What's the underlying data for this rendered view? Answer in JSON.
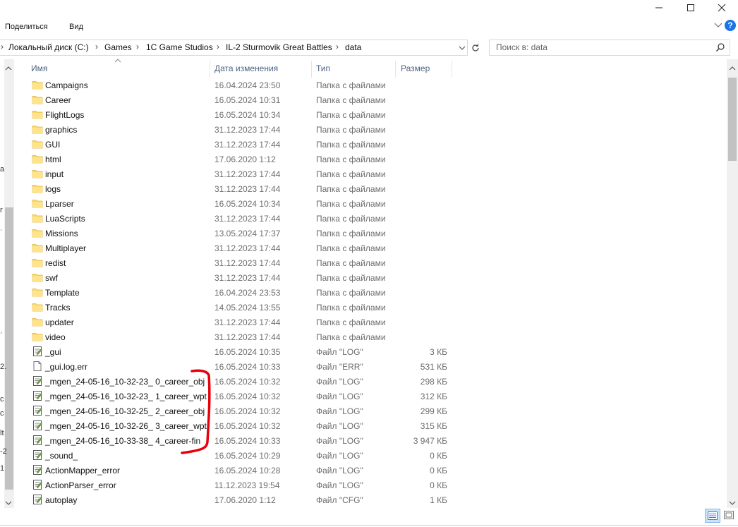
{
  "ribbon": {
    "share_tab": "Поделиться",
    "view_tab": "Вид"
  },
  "address": {
    "crumbs": [
      "Локальный диск (C:)",
      "Games",
      "1C Game Studios",
      "IL-2 Sturmovik Great Battles",
      "data"
    ]
  },
  "search": {
    "placeholder": "Поиск в: data"
  },
  "columns": {
    "name": "Имя",
    "date": "Дата изменения",
    "type": "Тип",
    "size": "Размер"
  },
  "nav_fragments": [
    "а",
    "r",
    "·",
    "·",
    "2.",
    "c",
    "c",
    "lt",
    "-2",
    "1"
  ],
  "files": [
    {
      "name": "Campaigns",
      "date": "16.04.2024 23:50",
      "type": "Папка с файлами",
      "size": "",
      "icon": "folder-icon"
    },
    {
      "name": "Career",
      "date": "16.05.2024 10:31",
      "type": "Папка с файлами",
      "size": "",
      "icon": "folder-icon"
    },
    {
      "name": "FlightLogs",
      "date": "16.05.2024 10:34",
      "type": "Папка с файлами",
      "size": "",
      "icon": "folder-icon"
    },
    {
      "name": "graphics",
      "date": "31.12.2023 17:44",
      "type": "Папка с файлами",
      "size": "",
      "icon": "folder-icon"
    },
    {
      "name": "GUI",
      "date": "31.12.2023 17:44",
      "type": "Папка с файлами",
      "size": "",
      "icon": "folder-icon"
    },
    {
      "name": "html",
      "date": "17.06.2020 1:12",
      "type": "Папка с файлами",
      "size": "",
      "icon": "folder-icon"
    },
    {
      "name": "input",
      "date": "31.12.2023 17:44",
      "type": "Папка с файлами",
      "size": "",
      "icon": "folder-icon"
    },
    {
      "name": "logs",
      "date": "31.12.2023 17:44",
      "type": "Папка с файлами",
      "size": "",
      "icon": "folder-icon"
    },
    {
      "name": "Lparser",
      "date": "16.05.2024 10:34",
      "type": "Папка с файлами",
      "size": "",
      "icon": "folder-icon"
    },
    {
      "name": "LuaScripts",
      "date": "31.12.2023 17:44",
      "type": "Папка с файлами",
      "size": "",
      "icon": "folder-icon"
    },
    {
      "name": "Missions",
      "date": "13.05.2024 17:37",
      "type": "Папка с файлами",
      "size": "",
      "icon": "folder-icon"
    },
    {
      "name": "Multiplayer",
      "date": "31.12.2023 17:44",
      "type": "Папка с файлами",
      "size": "",
      "icon": "folder-icon"
    },
    {
      "name": "redist",
      "date": "31.12.2023 17:44",
      "type": "Папка с файлами",
      "size": "",
      "icon": "folder-icon"
    },
    {
      "name": "swf",
      "date": "31.12.2023 17:44",
      "type": "Папка с файлами",
      "size": "",
      "icon": "folder-icon"
    },
    {
      "name": "Template",
      "date": "16.04.2024 23:53",
      "type": "Папка с файлами",
      "size": "",
      "icon": "folder-icon"
    },
    {
      "name": "Tracks",
      "date": "14.05.2024 13:55",
      "type": "Папка с файлами",
      "size": "",
      "icon": "folder-icon"
    },
    {
      "name": "updater",
      "date": "31.12.2023 17:44",
      "type": "Папка с файлами",
      "size": "",
      "icon": "folder-icon"
    },
    {
      "name": "video",
      "date": "31.12.2023 17:44",
      "type": "Папка с файлами",
      "size": "",
      "icon": "folder-icon"
    },
    {
      "name": "_gui",
      "date": "16.05.2024 10:35",
      "type": "Файл \"LOG\"",
      "size": "3 КБ",
      "icon": "log-file-icon"
    },
    {
      "name": "_gui.log.err",
      "date": "16.05.2024 10:33",
      "type": "Файл \"ERR\"",
      "size": "531 КБ",
      "icon": "blank-file-icon"
    },
    {
      "name": "_mgen_24-05-16_10-32-23_ 0_career_obj",
      "date": "16.05.2024 10:32",
      "type": "Файл \"LOG\"",
      "size": "298 КБ",
      "icon": "log-file-icon"
    },
    {
      "name": "_mgen_24-05-16_10-32-23_ 1_career_wpt",
      "date": "16.05.2024 10:32",
      "type": "Файл \"LOG\"",
      "size": "312 КБ",
      "icon": "log-file-icon"
    },
    {
      "name": "_mgen_24-05-16_10-32-25_ 2_career_obj",
      "date": "16.05.2024 10:32",
      "type": "Файл \"LOG\"",
      "size": "299 КБ",
      "icon": "log-file-icon"
    },
    {
      "name": "_mgen_24-05-16_10-32-26_ 3_career_wpt",
      "date": "16.05.2024 10:32",
      "type": "Файл \"LOG\"",
      "size": "315 КБ",
      "icon": "log-file-icon"
    },
    {
      "name": "_mgen_24-05-16_10-33-38_ 4_career-fin",
      "date": "16.05.2024 10:33",
      "type": "Файл \"LOG\"",
      "size": "3 947 КБ",
      "icon": "log-file-icon"
    },
    {
      "name": "_sound_",
      "date": "16.05.2024 10:29",
      "type": "Файл \"LOG\"",
      "size": "0 КБ",
      "icon": "log-file-icon"
    },
    {
      "name": "ActionMapper_error",
      "date": "16.05.2024 10:28",
      "type": "Файл \"LOG\"",
      "size": "0 КБ",
      "icon": "log-file-icon"
    },
    {
      "name": "ActionParser_error",
      "date": "11.12.2023 19:54",
      "type": "Файл \"LOG\"",
      "size": "0 КБ",
      "icon": "log-file-icon"
    },
    {
      "name": "autoplay",
      "date": "17.06.2020 1:12",
      "type": "Файл \"CFG\"",
      "size": "1 КБ",
      "icon": "log-file-icon"
    }
  ],
  "colors": {
    "folder": "#ffd968",
    "header_text": "#4d6181",
    "annotation": "#e8000b",
    "help": "#1a73e8"
  }
}
